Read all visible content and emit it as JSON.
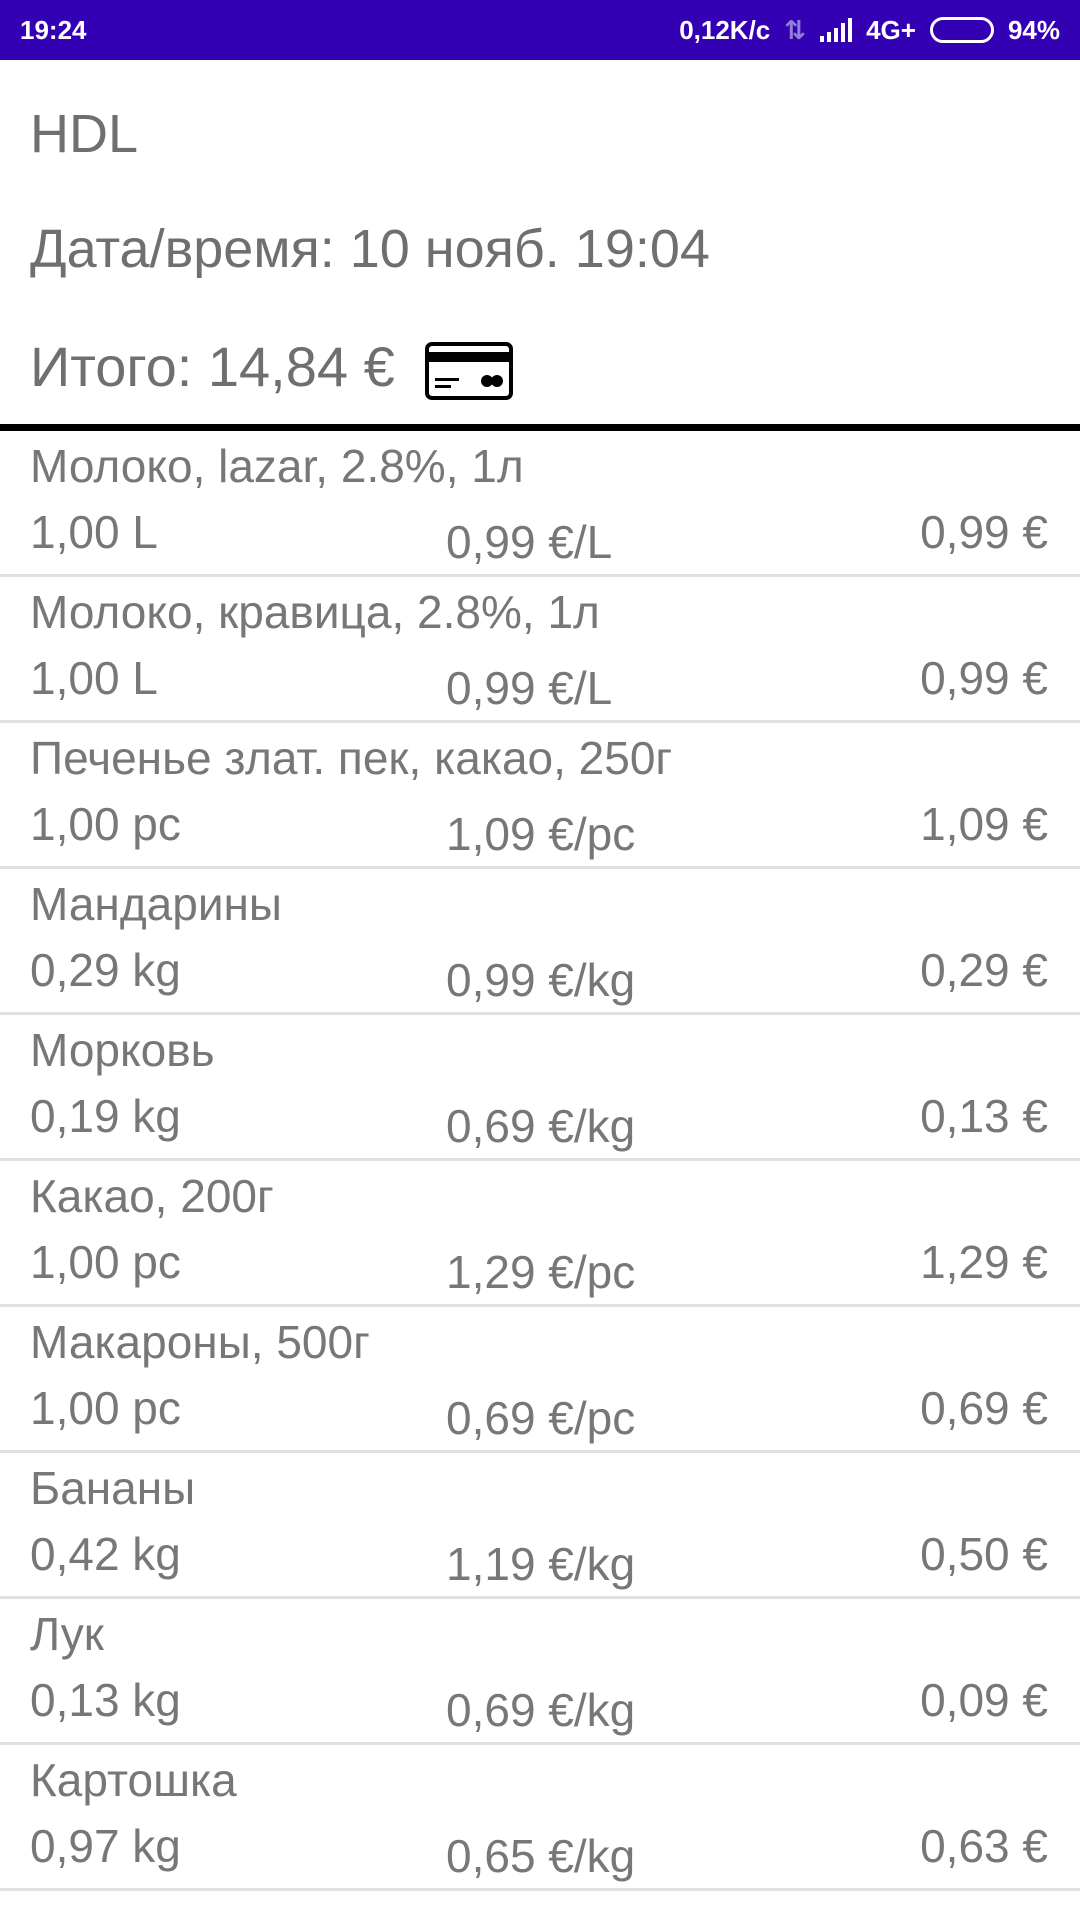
{
  "status_bar": {
    "time": "19:24",
    "network_speed": "0,12K/c",
    "network_type": "4G+",
    "battery_level": 0.94,
    "battery_text": "94%"
  },
  "receipt": {
    "store": "HDL",
    "datetime": "Дата/время: 10 нояб. 19:04",
    "total": "Итого: 14,84 €",
    "payment_icon": "credit-card-icon"
  },
  "items": [
    {
      "name": "Молоко, lazar, 2.8%, 1л",
      "qty": "1,00 L",
      "unit_price": "0,99 €/L",
      "sum": "0,99 €"
    },
    {
      "name": "Молоко, кравица, 2.8%, 1л",
      "qty": "1,00 L",
      "unit_price": "0,99 €/L",
      "sum": "0,99 €"
    },
    {
      "name": "Печенье злат. пек, какао, 250г",
      "qty": "1,00 pc",
      "unit_price": "1,09 €/pc",
      "sum": "1,09 €"
    },
    {
      "name": "Мандарины",
      "qty": "0,29 kg",
      "unit_price": "0,99 €/kg",
      "sum": "0,29 €"
    },
    {
      "name": "Морковь",
      "qty": "0,19 kg",
      "unit_price": "0,69 €/kg",
      "sum": "0,13 €"
    },
    {
      "name": "Какао, 200г",
      "qty": "1,00 pc",
      "unit_price": "1,29 €/pc",
      "sum": "1,29 €"
    },
    {
      "name": "Макароны, 500г",
      "qty": "1,00 pc",
      "unit_price": "0,69 €/pc",
      "sum": "0,69 €"
    },
    {
      "name": "Бананы",
      "qty": "0,42 kg",
      "unit_price": "1,19 €/kg",
      "sum": "0,50 €"
    },
    {
      "name": "Лук",
      "qty": "0,13 kg",
      "unit_price": "0,69 €/kg",
      "sum": "0,09 €"
    },
    {
      "name": "Картошка",
      "qty": "0,97 kg",
      "unit_price": "0,65 €/kg",
      "sum": "0,63 €"
    }
  ]
}
